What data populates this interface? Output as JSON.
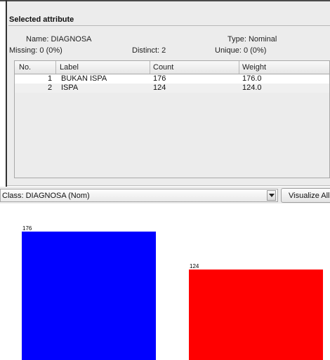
{
  "panel": {
    "title": "Selected attribute",
    "name_text": "Name: DIAGNOSA",
    "type_text": "Type: Nominal",
    "missing_text": "Missing: 0 (0%)",
    "distinct_text": "Distinct: 2",
    "unique_text": "Unique: 0 (0%)"
  },
  "table": {
    "headers": [
      "No.",
      "Label",
      "Count",
      "Weight"
    ],
    "rows": [
      {
        "no": "1",
        "label": "BUKAN ISPA",
        "count": "176",
        "weight": "176.0"
      },
      {
        "no": "2",
        "label": "ISPA",
        "count": "124",
        "weight": "124.0"
      }
    ]
  },
  "class_selector": {
    "value": "Class: DIAGNOSA (Nom)",
    "visualize_label": "Visualize All"
  },
  "chart_data": {
    "type": "bar",
    "categories": [
      "BUKAN ISPA",
      "ISPA"
    ],
    "values": [
      176,
      124
    ],
    "data_labels": [
      "176",
      "124"
    ],
    "colors": [
      "#0000ff",
      "#ff0000"
    ],
    "title": "",
    "xlabel": "",
    "ylabel": ""
  }
}
